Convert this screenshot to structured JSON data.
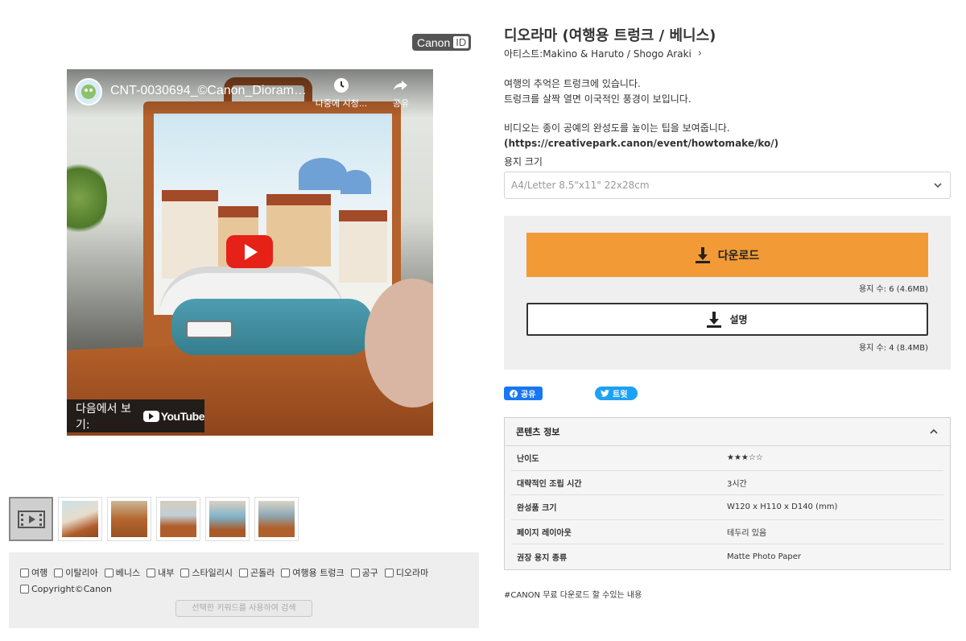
{
  "badge": {
    "canon": "Canon",
    "id": "ID"
  },
  "video": {
    "title": "CNT-0030694_©Canon_Diorama (...",
    "watch_later": "나중에 시청...",
    "share": "공유",
    "watch_on": "다음에서 보기:",
    "youtube": "YouTube"
  },
  "thumbnails": {
    "count_images": 5,
    "active": "video-thumbnail"
  },
  "tags": {
    "items": [
      "여행",
      "이탈리아",
      "베니스",
      "내부",
      "스타일리시",
      "곤돌라",
      "여행용 트렁크",
      "공구",
      "디오라마",
      "Copyright©Canon"
    ],
    "search_button": "선택한 키워드를 사용하여 검색"
  },
  "product": {
    "title": "디오라마 (여행용 트렁크 / 베니스)",
    "artist": "아티스트:Makino & Haruto / Shogo Araki",
    "desc_lines_1": [
      "여행의 추억은 트렁크에 있습니다.",
      "트렁크를 살짝 열면 이국적인 풍경이 보입니다."
    ],
    "desc_line_2": "비디오는 종이 공예의 완성도를 높이는 팁을 보여줍니다.",
    "desc_url": "(https://creativepark.canon/event/howtomake/ko/)",
    "paper_label": "용지 크기",
    "paper_selected": "A4/Letter 8.5\"x11\" 22x28cm"
  },
  "download": {
    "download_label": "다운로드",
    "download_count": "용지 수: 6 (4.6MB)",
    "instructions_label": "설명",
    "instructions_count": "용지 수: 4 (8.4MB)",
    "accent_color": "#f29a35"
  },
  "social": {
    "facebook": "공유",
    "twitter": "트윗"
  },
  "content_info": {
    "header": "콘텐츠 정보",
    "rows": [
      {
        "key": "난이도",
        "value": "★★★☆☆"
      },
      {
        "key": "대략적인 조립 시간",
        "value": "3시간"
      },
      {
        "key": "완성품 크기",
        "value": "W120 x H110 x D140 (mm)"
      },
      {
        "key": "페이지 레이아웃",
        "value": "테두리 있음"
      },
      {
        "key": "권장 용지 종류",
        "value": "Matte Photo Paper"
      }
    ]
  },
  "footer_note": "#CANON 무료 다운로드 할 수있는 내용"
}
